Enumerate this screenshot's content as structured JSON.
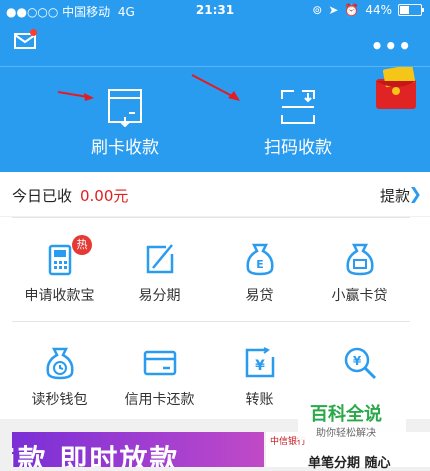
{
  "status_bar": {
    "carrier": "●●○○○ 中国移动",
    "network": "4G",
    "time": "21:31",
    "battery": "44%"
  },
  "header": {
    "mail_icon": "mail-icon",
    "more_icon": "more-icon",
    "more_glyph": "•••",
    "colors": {
      "primary": "#2a9cf0",
      "notify_dot": "#ff3b30"
    }
  },
  "hero": {
    "actions": [
      {
        "label": "刷卡收款",
        "icon": "card-reader-icon"
      },
      {
        "label": "扫码收款",
        "icon": "scan-icon"
      }
    ]
  },
  "summary": {
    "today_label": "今日已收",
    "today_amount": "0.00元",
    "withdraw_label": "提款",
    "amount_color": "#e02020"
  },
  "grid": {
    "row1": [
      {
        "label": "申请收款宝",
        "icon": "pos-terminal-icon",
        "badge": "热"
      },
      {
        "label": "易分期",
        "icon": "installment-icon"
      },
      {
        "label": "易贷",
        "icon": "money-bag-e-icon"
      },
      {
        "label": "小赢卡贷",
        "icon": "money-bag-card-icon"
      }
    ],
    "row2": [
      {
        "label": "读秒钱包",
        "icon": "money-bag-clock-icon"
      },
      {
        "label": "信用卡还款",
        "icon": "credit-card-icon"
      },
      {
        "label": "转账",
        "icon": "transfer-yen-icon"
      },
      {
        "label": "",
        "icon": "search-yen-icon"
      }
    ]
  },
  "banner": {
    "left_text": "i款 即时放款",
    "bank_name": "中信银行",
    "cta": "单笔分期  随心"
  },
  "watermark": {
    "title": "百科全说",
    "subtitle": "助你轻松解决"
  }
}
